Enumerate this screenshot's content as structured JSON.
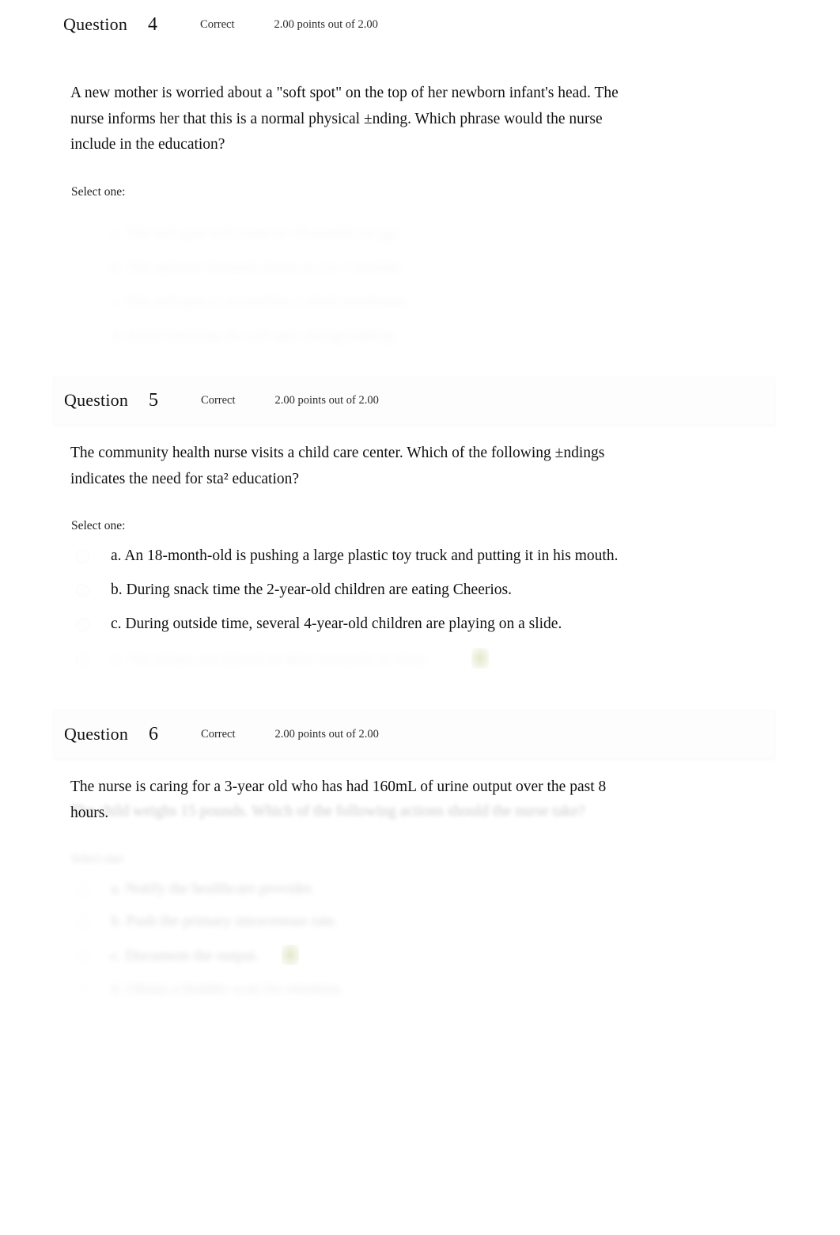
{
  "labels": {
    "question_word": "Question",
    "select_one": "Select one:"
  },
  "questions": [
    {
      "number": "4",
      "state": "Correct",
      "marks": "2.00 points out of 2.00",
      "text": "A new mother is worried about a \"soft spot\" on the top of her newborn infant's head. The nurse informs her that this is a normal physical ±nding. Which phrase would the nurse include in the education?",
      "select_one": "Select one:",
      "options": [
        {
          "label": "a. The soft spot will close by 18 months of age.",
          "correct": false
        },
        {
          "label": "b. The anterior fontanel closes at 2 to 3 months.",
          "correct": false
        },
        {
          "label": "c. The soft spot is covered by a thick membrane.",
          "correct": false
        },
        {
          "label": "d. Avoid touching the soft spot during bathing.",
          "correct": false
        }
      ]
    },
    {
      "number": "5",
      "state": "Correct",
      "marks": "2.00 points out of 2.00",
      "text": "The community health nurse visits a child care center. Which of the following ±ndings indicates the need for sta² education?",
      "select_one": "Select one:",
      "options": [
        {
          "label": "a. An 18-month-old is pushing a large plastic toy truck and putting it in his mouth.",
          "correct": false
        },
        {
          "label": "b. During snack time the 2-year-old children are eating Cheerios.",
          "correct": false
        },
        {
          "label": "c. During outside time, several 4-year-old children are playing on a slide.",
          "correct": false
        },
        {
          "label": "d. The infants are placed on their stomachs to sleep.",
          "correct": true
        }
      ]
    },
    {
      "number": "6",
      "state": "Correct",
      "marks": "2.00 points out of 2.00",
      "text": "The nurse is caring for a 3-year old who has had 160mL of urine output over the past 8 hours.",
      "text_line2": "The child weighs 15 pounds. Which of the following actions should the nurse take?",
      "select_one": "Select one:",
      "options": [
        {
          "label": "a. Notify the healthcare provider.",
          "correct": false
        },
        {
          "label": "b. Push the primary intravenous rate.",
          "correct": false
        },
        {
          "label": "c. Document the output.",
          "correct": true
        },
        {
          "label": "d. Obtain a bladder scan for retention.",
          "correct": false
        }
      ]
    }
  ]
}
